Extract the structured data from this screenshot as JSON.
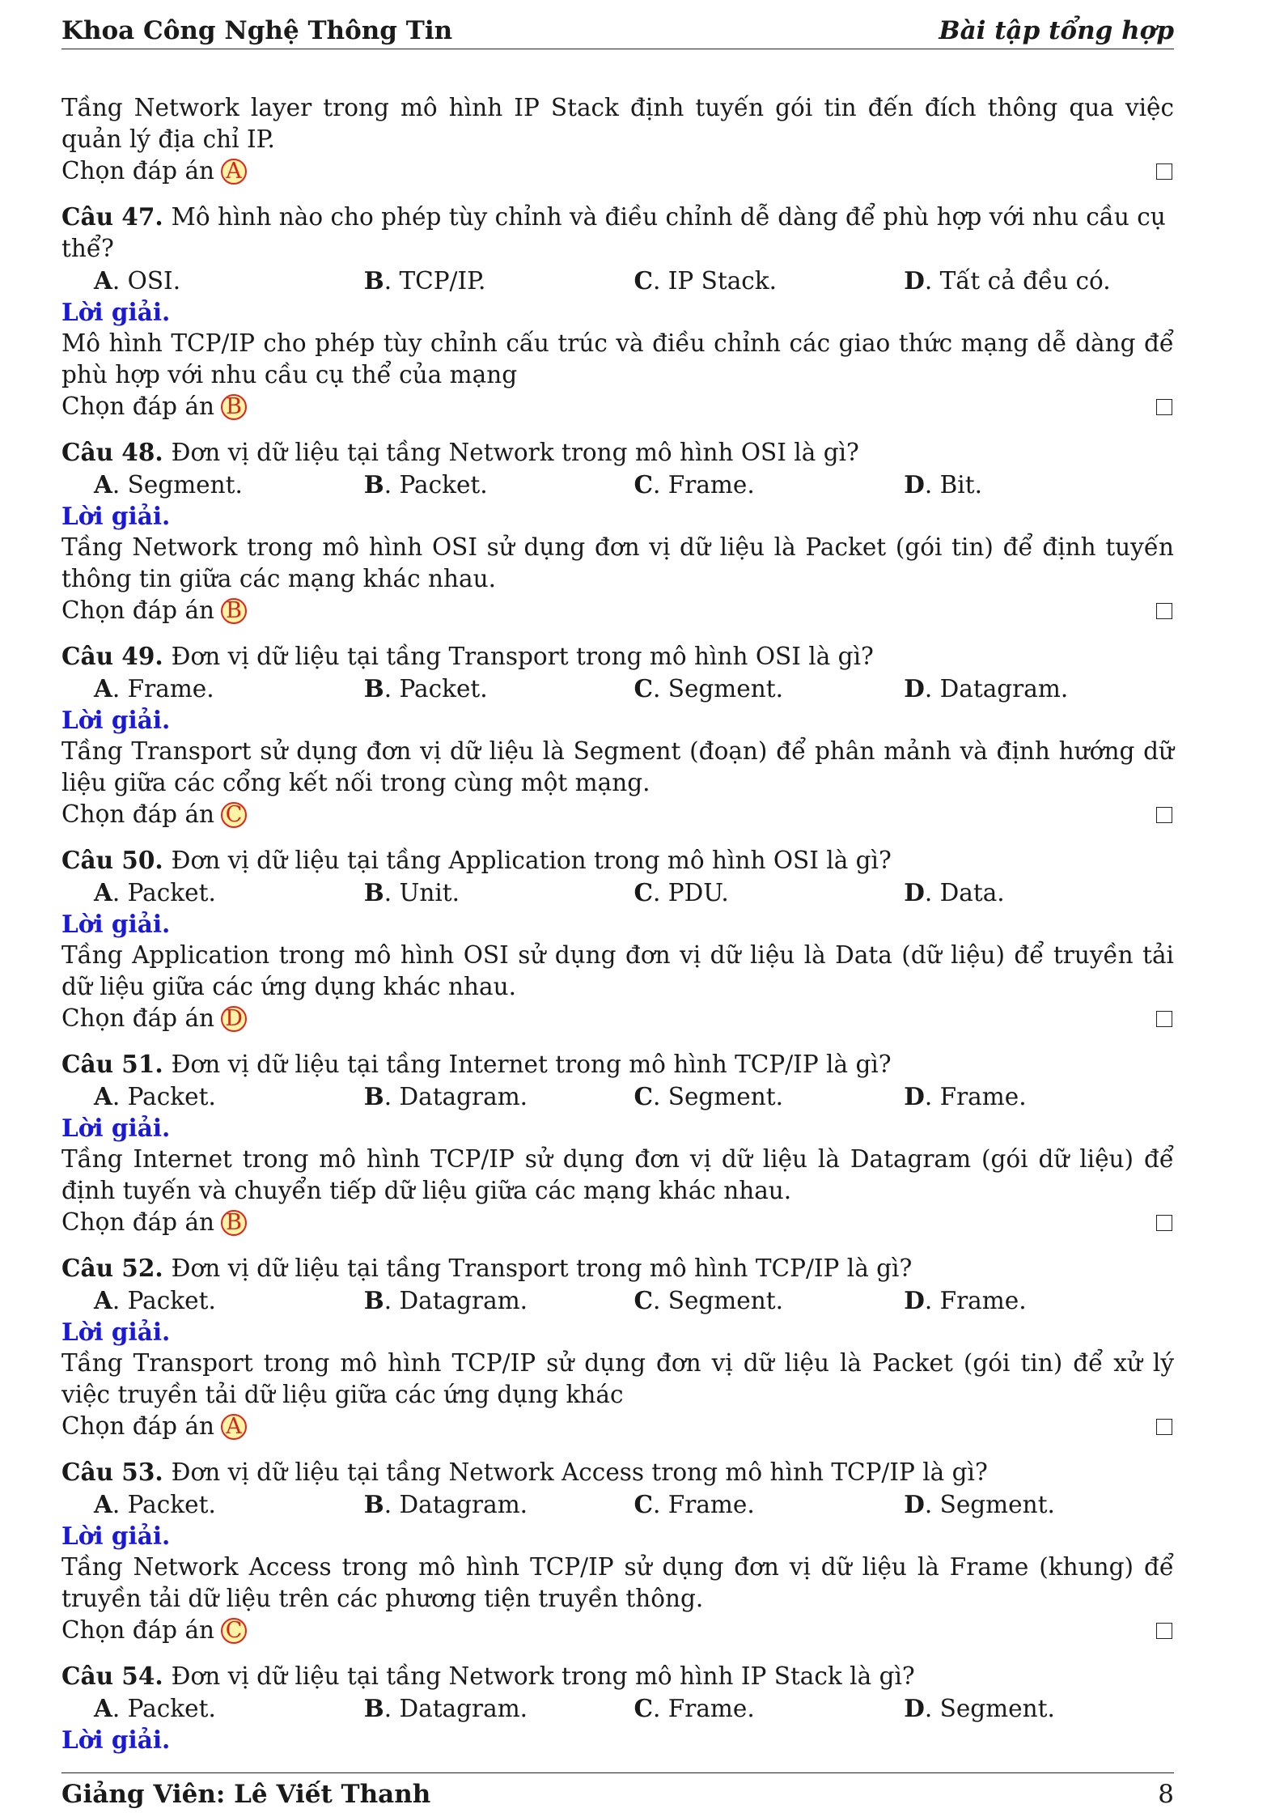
{
  "header": {
    "left": "Khoa Công Nghệ Thông Tin",
    "right": "Bài tập tổng hợp"
  },
  "intro": {
    "explanation": "Tầng Network layer trong mô hình IP Stack định tuyến gói tin đến đích thông qua việc quản lý địa chỉ IP.",
    "answer_label": "Chọn đáp án",
    "answer": "A"
  },
  "questions": [
    {
      "num": "Câu 47.",
      "text": "Mô hình nào cho phép tùy chỉnh và điều chỉnh dễ dàng để phù hợp với nhu cầu cụ thể?",
      "options": [
        "OSI.",
        "TCP/IP.",
        "IP Stack.",
        "Tất cả đều có."
      ],
      "solution_label": "Lời giải.",
      "explanation": "Mô hình TCP/IP cho phép tùy chỉnh cấu trúc và điều chỉnh các giao thức mạng dễ dàng để phù hợp với nhu cầu cụ thể của mạng",
      "answer_label": "Chọn đáp án",
      "answer": "B"
    },
    {
      "num": "Câu 48.",
      "text": "Đơn vị dữ liệu tại tầng Network trong mô hình OSI là gì?",
      "options": [
        "Segment.",
        "Packet.",
        "Frame.",
        "Bit."
      ],
      "solution_label": "Lời giải.",
      "explanation": "Tầng Network trong mô hình OSI sử dụng đơn vị dữ liệu là Packet (gói tin) để định tuyến thông tin giữa các mạng khác nhau.",
      "answer_label": "Chọn đáp án",
      "answer": "B"
    },
    {
      "num": "Câu 49.",
      "text": "Đơn vị dữ liệu tại tầng Transport trong mô hình OSI là gì?",
      "options": [
        "Frame.",
        "Packet.",
        "Segment.",
        "Datagram."
      ],
      "solution_label": "Lời giải.",
      "explanation": "Tầng Transport sử dụng đơn vị dữ liệu là Segment (đoạn) để phân mảnh và định hướng dữ liệu giữa các cổng kết nối trong cùng một mạng.",
      "answer_label": "Chọn đáp án",
      "answer": "C"
    },
    {
      "num": "Câu 50.",
      "text": "Đơn vị dữ liệu tại tầng Application trong mô hình OSI là gì?",
      "options": [
        "Packet.",
        "Unit.",
        "PDU.",
        "Data."
      ],
      "solution_label": "Lời giải.",
      "explanation": "Tầng Application trong mô hình OSI sử dụng đơn vị dữ liệu là Data (dữ liệu) để truyền tải dữ liệu giữa các ứng dụng khác nhau.",
      "answer_label": "Chọn đáp án",
      "answer": "D"
    },
    {
      "num": "Câu 51.",
      "text": "Đơn vị dữ liệu tại tầng Internet trong mô hình TCP/IP là gì?",
      "options": [
        "Packet.",
        "Datagram.",
        "Segment.",
        "Frame."
      ],
      "solution_label": "Lời giải.",
      "explanation": "Tầng Internet trong mô hình TCP/IP sử dụng đơn vị dữ liệu là Datagram (gói dữ liệu) để định tuyến và chuyển tiếp dữ liệu giữa các mạng khác nhau.",
      "answer_label": "Chọn đáp án",
      "answer": "B"
    },
    {
      "num": "Câu 52.",
      "text": "Đơn vị dữ liệu tại tầng Transport trong mô hình TCP/IP là gì?",
      "options": [
        "Packet.",
        "Datagram.",
        "Segment.",
        "Frame."
      ],
      "solution_label": "Lời giải.",
      "explanation": "Tầng Transport trong mô hình TCP/IP sử dụng đơn vị dữ liệu là Packet (gói tin) để xử lý việc truyền tải dữ liệu giữa các ứng dụng khác",
      "answer_label": "Chọn đáp án",
      "answer": "A"
    },
    {
      "num": "Câu 53.",
      "text": "Đơn vị dữ liệu tại tầng Network Access trong mô hình TCP/IP là gì?",
      "options": [
        "Packet.",
        "Datagram.",
        "Frame.",
        "Segment."
      ],
      "solution_label": "Lời giải.",
      "explanation": "Tầng Network Access trong mô hình TCP/IP sử dụng đơn vị dữ liệu là Frame (khung) để truyền tải dữ liệu trên các phương tiện truyền thông.",
      "answer_label": "Chọn đáp án",
      "answer": "C"
    },
    {
      "num": "Câu 54.",
      "text": "Đơn vị dữ liệu tại tầng Network trong mô hình IP Stack là gì?",
      "options": [
        "Packet.",
        "Datagram.",
        "Frame.",
        "Segment."
      ],
      "solution_label": "Lời giải.",
      "explanation": "",
      "answer_label": "",
      "answer": ""
    }
  ],
  "option_letters": [
    "A",
    "B",
    "C",
    "D"
  ],
  "footer": {
    "left": "Giảng Viên: Lê Viết Thanh",
    "right": "8"
  },
  "colors": {
    "solution_label": "#1a1ad6",
    "answer_circle_border": "#e0261b",
    "answer_circle_fill": "#fff3a6"
  }
}
